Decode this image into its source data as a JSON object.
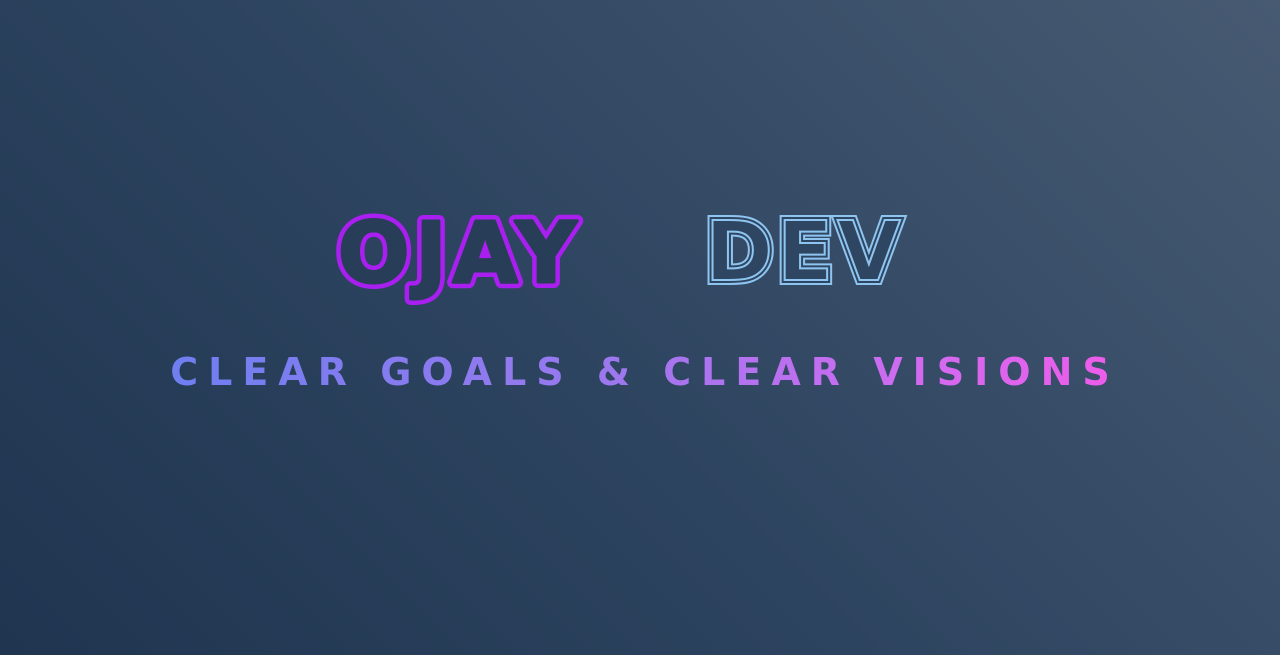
{
  "logo": {
    "word1": "OJAY",
    "word2": "DEV"
  },
  "tagline": "CLEAR GOALS & CLEAR VISIONS",
  "colors": {
    "background_start": "#1f3550",
    "background_end": "#475a72",
    "logo_purple": "#a81ff0",
    "logo_blue": "#8ec5f0",
    "tagline_start": "#6f7ff0",
    "tagline_end": "#ee5cea"
  }
}
